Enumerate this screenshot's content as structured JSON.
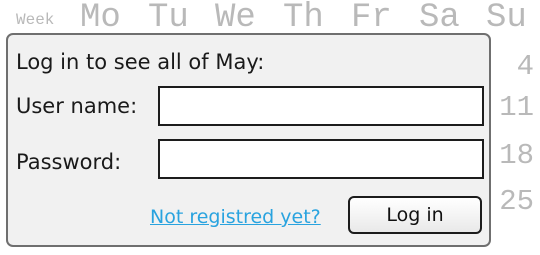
{
  "calendar": {
    "week_label": "Week",
    "days": [
      "Mo",
      "Tu",
      "We",
      "Th",
      "Fr",
      "Sa",
      "Su"
    ],
    "visible_dates": [
      "4",
      "11",
      "18",
      "25"
    ]
  },
  "login": {
    "title": "Log in to see all of May:",
    "username_label": "User name:",
    "username_value": "",
    "password_label": "Password:",
    "password_value": "",
    "register_link": "Not registred yet?",
    "login_button": "Log in"
  },
  "colors": {
    "link": "#29a3df",
    "dialog_bg": "#f1f1f1",
    "calendar_text": "#b9b9b9"
  }
}
